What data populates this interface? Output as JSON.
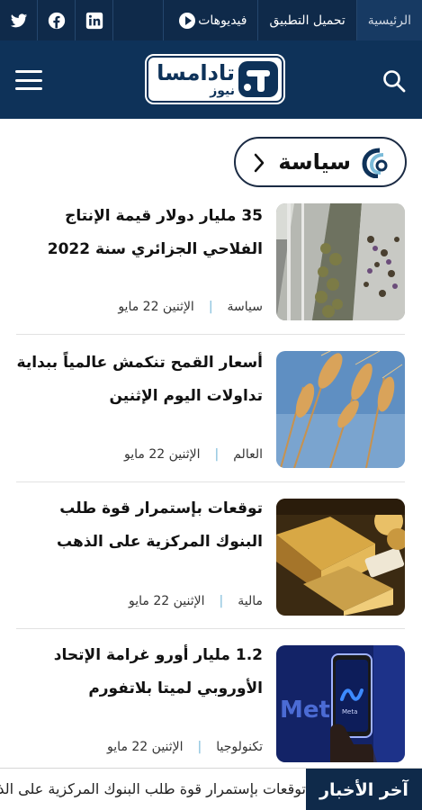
{
  "topbar": {
    "social": [
      {
        "name": "twitter-icon"
      },
      {
        "name": "facebook-icon"
      },
      {
        "name": "linkedin-icon"
      }
    ],
    "links": {
      "videos": "فيديوهات",
      "download_app": "تحميل التطبيق",
      "home": "الرئيسية"
    }
  },
  "header": {
    "logo_name": "تادامسا",
    "logo_sub": "نيوز"
  },
  "section": {
    "title": "سياسة"
  },
  "articles": [
    {
      "headline": "35 مليار دولار قيمة الإنتاج الفلاحي الجزائري سنة 2022",
      "category": "سياسة",
      "date": "الإثنين 22 مايو",
      "image": "agriculture-dates-conveyor"
    },
    {
      "headline": "أسعار القمح تنكمش عالمياً ببداية تداولات اليوم الإثنين",
      "category": "العالم",
      "date": "الإثنين 22 مايو",
      "image": "wheat-ears"
    },
    {
      "headline": "توقعات بإستمرار قوة طلب البنوك المركزية على الذهب",
      "category": "مالية",
      "date": "الإثنين 22 مايو",
      "image": "gold-bars"
    },
    {
      "headline": "1.2 مليار أورو غرامة الإتحاد الأوروبي لميتا بلاتفورم",
      "category": "تكنولوجيا",
      "date": "الإثنين 22 مايو",
      "image": "meta-logo-phone"
    }
  ],
  "breaking": {
    "label": "آخر الأخبار",
    "ticker": "توقعات بإستمرار قوة طلب البنوك المركزية على الذهب"
  },
  "colors": {
    "navy": "#0e3259",
    "topbar": "#0f2a4a",
    "separator": "#7bbbd9"
  }
}
